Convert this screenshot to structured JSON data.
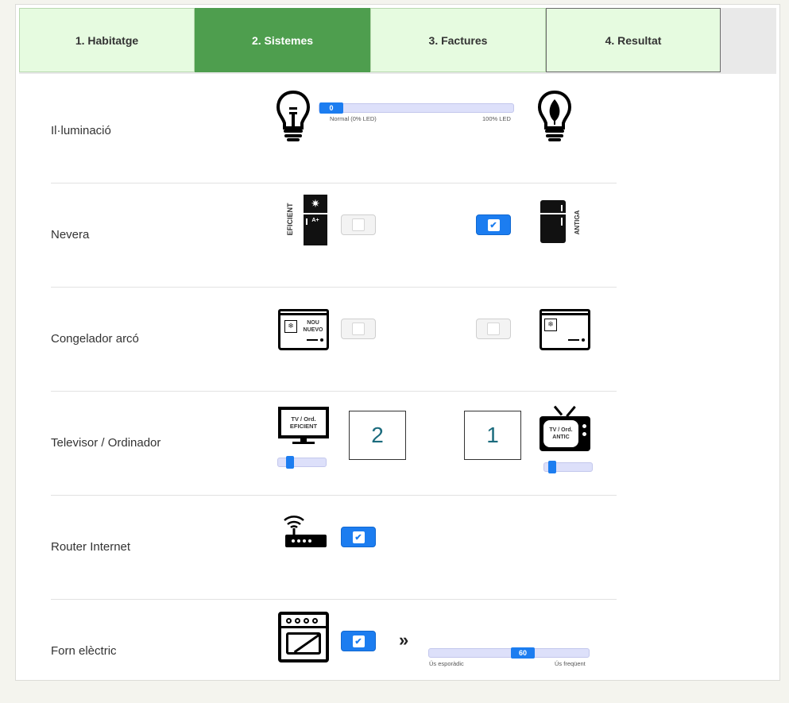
{
  "tabs": [
    {
      "label": "1. Habitatge",
      "active": false
    },
    {
      "label": "2. Sistemes",
      "active": true
    },
    {
      "label": "3. Factures",
      "active": false
    },
    {
      "label": "4. Resultat",
      "active": false
    }
  ],
  "rows": {
    "lighting": {
      "label": "Il·luminació",
      "slider_value": "0",
      "slider_fraction": 0,
      "min_label": "Normal (0% LED)",
      "max_label": "100% LED"
    },
    "fridge": {
      "label": "Nevera",
      "left_icon_text": "EFICIENT",
      "energy_class": "A+",
      "right_icon_text": "ANTIGA",
      "efficient_checked": false,
      "old_checked": true
    },
    "freezer": {
      "label": "Congelador arcó",
      "new_line1": "NOU",
      "new_line2": "NUEVO",
      "new_checked": false,
      "old_checked": false
    },
    "tv": {
      "label": "Televisor / Ordinador",
      "eff_line1": "TV / Ord.",
      "eff_line2": "EFICIENT",
      "old_line1": "TV / Ord.",
      "old_line2": "ANTIC",
      "efficient_count": "2",
      "old_count": "1",
      "efficient_slider_fraction": 0.2,
      "old_slider_fraction": 0.1
    },
    "router": {
      "label": "Router Internet",
      "checked": true
    },
    "oven": {
      "label": "Forn elèctric",
      "checked": true,
      "chevron": "»",
      "slider_value": "60",
      "slider_fraction": 0.6,
      "min_label": "Ús esporàdic",
      "max_label": "Ús freqüent"
    }
  },
  "colors": {
    "active_tab": "#4e9e4e",
    "inactive_tab": "#e6fbe0",
    "accent": "#1c7df0",
    "number": "#1b6b7d"
  }
}
